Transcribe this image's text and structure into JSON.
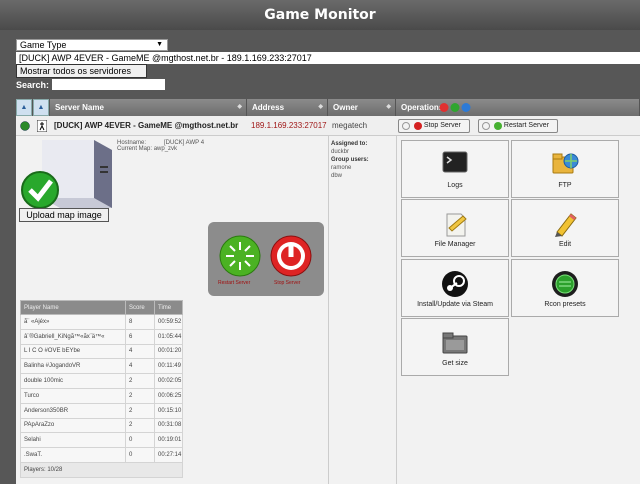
{
  "header": {
    "title": "Game Monitor"
  },
  "filters": {
    "game_type": "Game Type",
    "server_option": "[DUCK] AWP 4EVER - GameME @mgthost.net.br - 189.1.169.233:27017",
    "show_all": "Mostrar todos os servidores",
    "search_label": "Search:"
  },
  "table": {
    "col_server": "Server Name",
    "col_address": "Address",
    "col_owner": "Owner",
    "col_operations": "Operations",
    "server_name": "[DUCK] AWP 4EVER - GameME @mgthost.net.br",
    "address": "189.1.169.233:27017",
    "owner": "megatech"
  },
  "details": {
    "hostname_label": "Hostname:",
    "hostname_value": "[DUCK] AWP 4",
    "map_label": "Current Map:",
    "map_value": "awp_zvk",
    "upload_button": "Upload map image",
    "restart_label": "Restart Server",
    "stop_label": "Stop Server"
  },
  "owner_panel": {
    "assigned_label": "Assigned to:",
    "assigned_value": "duckbr",
    "group_label": "Group users:",
    "group_users": [
      "ramone",
      "dbw"
    ]
  },
  "players": {
    "headers": [
      "Player Name",
      "Score",
      "Time"
    ],
    "rows": [
      [
        "ã¨ «Ajéx»",
        "8",
        "00:59:52"
      ],
      [
        "â¨®Gabriell_KiNgã™«ãx¨ä™«",
        "6",
        "01:05:44"
      ],
      [
        "L I C O #OVE bEYbe",
        "4",
        "00:01:20"
      ],
      [
        "Balinha #JogandoVR",
        "4",
        "00:11:49"
      ],
      [
        "double 100mic",
        "2",
        "00:02:05"
      ],
      [
        "Turco",
        "2",
        "00:06:25"
      ],
      [
        "Anderson350BR",
        "2",
        "00:15:10"
      ],
      [
        "PApAraZzo",
        "2",
        "00:31:08"
      ],
      [
        "Selahi",
        "0",
        "00:19:01"
      ],
      [
        ".SwaT.",
        "0",
        "00:27:14"
      ]
    ],
    "footer": "Players: 10/28"
  },
  "operations": {
    "stop_button": "Stop Server",
    "restart_button": "Restart Server",
    "tiles": [
      "Logs",
      "FTP",
      "File Manager",
      "Edit",
      "Install/Update via Steam",
      "Rcon presets",
      "Get size"
    ]
  }
}
